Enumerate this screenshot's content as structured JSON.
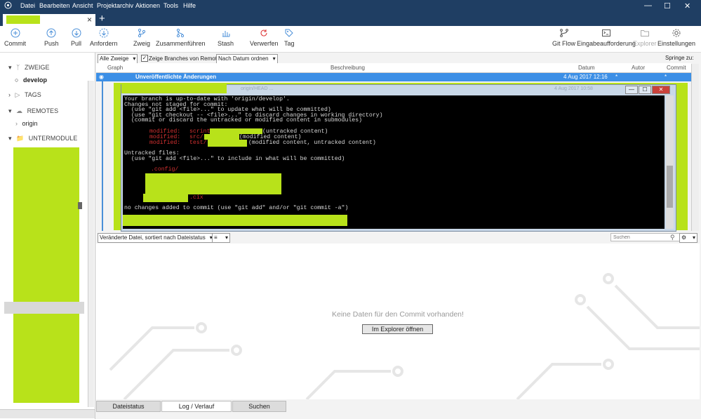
{
  "menu": [
    "Datei",
    "Bearbeiten",
    "Ansicht",
    "Projektarchiv",
    "Aktionen",
    "Tools",
    "Hilfe"
  ],
  "window_controls": {
    "minimize": "—",
    "maximize": "☐",
    "close": "✕"
  },
  "tab": {
    "close": "×",
    "add": "+"
  },
  "toolbar": {
    "left": [
      {
        "label": "Commit",
        "icon": "plus-circle-icon"
      },
      {
        "label": "Push",
        "icon": "arrow-up-circle-icon"
      },
      {
        "label": "Pull",
        "icon": "arrow-down-circle-icon"
      },
      {
        "label": "Anfordern",
        "icon": "fetch-icon"
      },
      {
        "label": "Zweig",
        "icon": "branch-icon"
      },
      {
        "label": "Zusammenführen",
        "icon": "merge-icon"
      },
      {
        "label": "Stash",
        "icon": "stash-icon"
      },
      {
        "label": "Verwerfen",
        "icon": "discard-icon"
      },
      {
        "label": "Tag",
        "icon": "tag-icon"
      }
    ],
    "right": [
      {
        "label": "Git Flow",
        "icon": "git-flow-icon"
      },
      {
        "label": "Eingabeaufforderung",
        "icon": "terminal-icon"
      },
      {
        "label": "Explorer",
        "icon": "folder-icon"
      },
      {
        "label": "Einstellungen",
        "icon": "gear-icon"
      }
    ]
  },
  "sidebar": {
    "branches_header": "ZWEIGE",
    "current_branch": "develop",
    "tags_header": "TAGS",
    "remotes_header": "REMOTES",
    "remote": "origin",
    "submodules_header": "UNTERMODULE"
  },
  "filters": {
    "branches": "Alle Zweige",
    "show_remote": "Zeige Branches von Remote",
    "order": "Nach Datum ordnen",
    "jump_to": "Springe zu:"
  },
  "columns": {
    "graph": "Graph",
    "description": "Beschreibung",
    "date": "Datum",
    "author": "Autor",
    "commit": "Commit"
  },
  "selected_row": {
    "description": "Unveröffentlichte Änderungen",
    "date": "4 Aug 2017 12:16",
    "author": "*",
    "commit": "*"
  },
  "second_row": {
    "description": "origin/HEAD ...",
    "date": "4 Aug 2017 10:58"
  },
  "terminal": {
    "lines": [
      "Your branch is up-to-date with 'origin/develop'.",
      "Changes not staged for commit:",
      "  (use \"git add <file>...\" to update what will be committed)",
      "  (use \"git checkout -- <file>...\" to discard changes in working directory)",
      "  (commit or discard the untracked or modified content in submodules)"
    ],
    "modified": [
      {
        "label": "modified:",
        "path": "scrint",
        "note": "(untracked content)"
      },
      {
        "label": "modified:",
        "path": "src/",
        "note": "(modified content)"
      },
      {
        "label": "modified:",
        "path": "test/",
        "note": "(modified content, untracked content)"
      }
    ],
    "untracked_header": "Untracked files:",
    "untracked_hint": "  (use \"git add <file>...\" to include in what will be committed)",
    "untracked_files": [
      ".config/",
      ".cix"
    ],
    "summary": "no changes added to commit (use \"git add\" and/or \"git commit -a\")"
  },
  "lower": {
    "file_sort": "Veränderte Datei, sortiert nach Dateistatus",
    "search_placeholder": "Suchen",
    "empty_message": "Keine Daten für den Commit vorhanden!",
    "explorer_button": "Im Explorer öffnen"
  },
  "bottom_tabs": [
    "Dateistatus",
    "Log / Verlauf",
    "Suchen"
  ],
  "colors": {
    "accent": "#1f3e63",
    "selection": "#3c8fe6",
    "redaction": "#b8e21a"
  }
}
